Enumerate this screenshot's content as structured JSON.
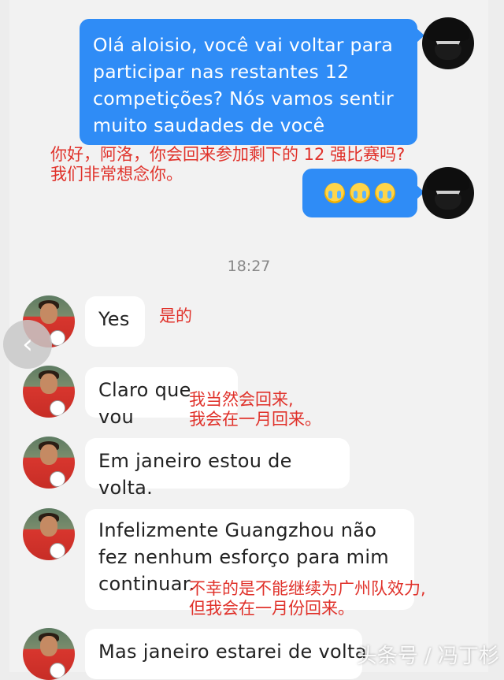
{
  "messages": {
    "sent_1": "Olá aloisio, você vai voltar para participar nas restantes 12 competições? Nós vamos sentir muito saudades de você",
    "sent_2_emoji": [
      "crying-face",
      "crying-face",
      "crying-face"
    ],
    "timestamp": "18:27",
    "recv_1": "Yes",
    "recv_2": "Claro que vou",
    "recv_3": "Em janeiro estou de volta.",
    "recv_4": "Infelizmente Guangzhou não fez nenhum esforço para mim continuar.",
    "recv_5": "Mas janeiro estarei de volta"
  },
  "translations": {
    "t1_line1": "你好，阿洛，你会回来参加剩下的 12 强比赛吗?",
    "t1_line2": "我们非常想念你。",
    "t2": "是的",
    "t3_line1": "我当然会回来,",
    "t3_line2": "我会在一月回来。",
    "t4_line1": "不幸的是不能继续为广州队效力,",
    "t4_line2": "但我会在一月份回来。"
  },
  "watermark": "头条号 / 冯丁杉",
  "colors": {
    "outgoing_bubble": "#2f8cf6",
    "incoming_bubble": "#ffffff",
    "annotation_red": "#e0322b",
    "background": "#f2f2f2"
  }
}
